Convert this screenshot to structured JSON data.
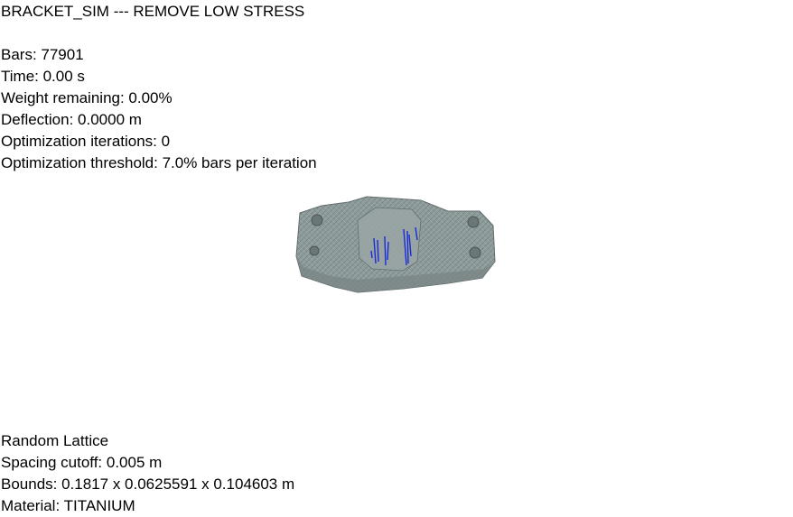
{
  "top_overlay": {
    "title": "BRACKET_SIM --- REMOVE LOW STRESS",
    "bars": "Bars: 77901",
    "time": "Time: 0.00 s",
    "weight_remaining": "Weight remaining: 0.00%",
    "deflection": "Deflection: 0.0000 m",
    "optimization_iterations": "Optimization iterations: 0",
    "optimization_threshold": "Optimization threshold: 7.0% bars per iteration"
  },
  "bottom_overlay": {
    "lattice_type": "Random Lattice",
    "spacing_cutoff": "Spacing cutoff: 0.005 m",
    "bounds": "Bounds: 0.1817 x 0.0625591 x 0.104603 m",
    "material": "Material: TITANIUM"
  },
  "model": {
    "surface_color": "#8f9c9c",
    "high_stress_color": "#1a2bd6",
    "background_color": "#ffffff"
  }
}
